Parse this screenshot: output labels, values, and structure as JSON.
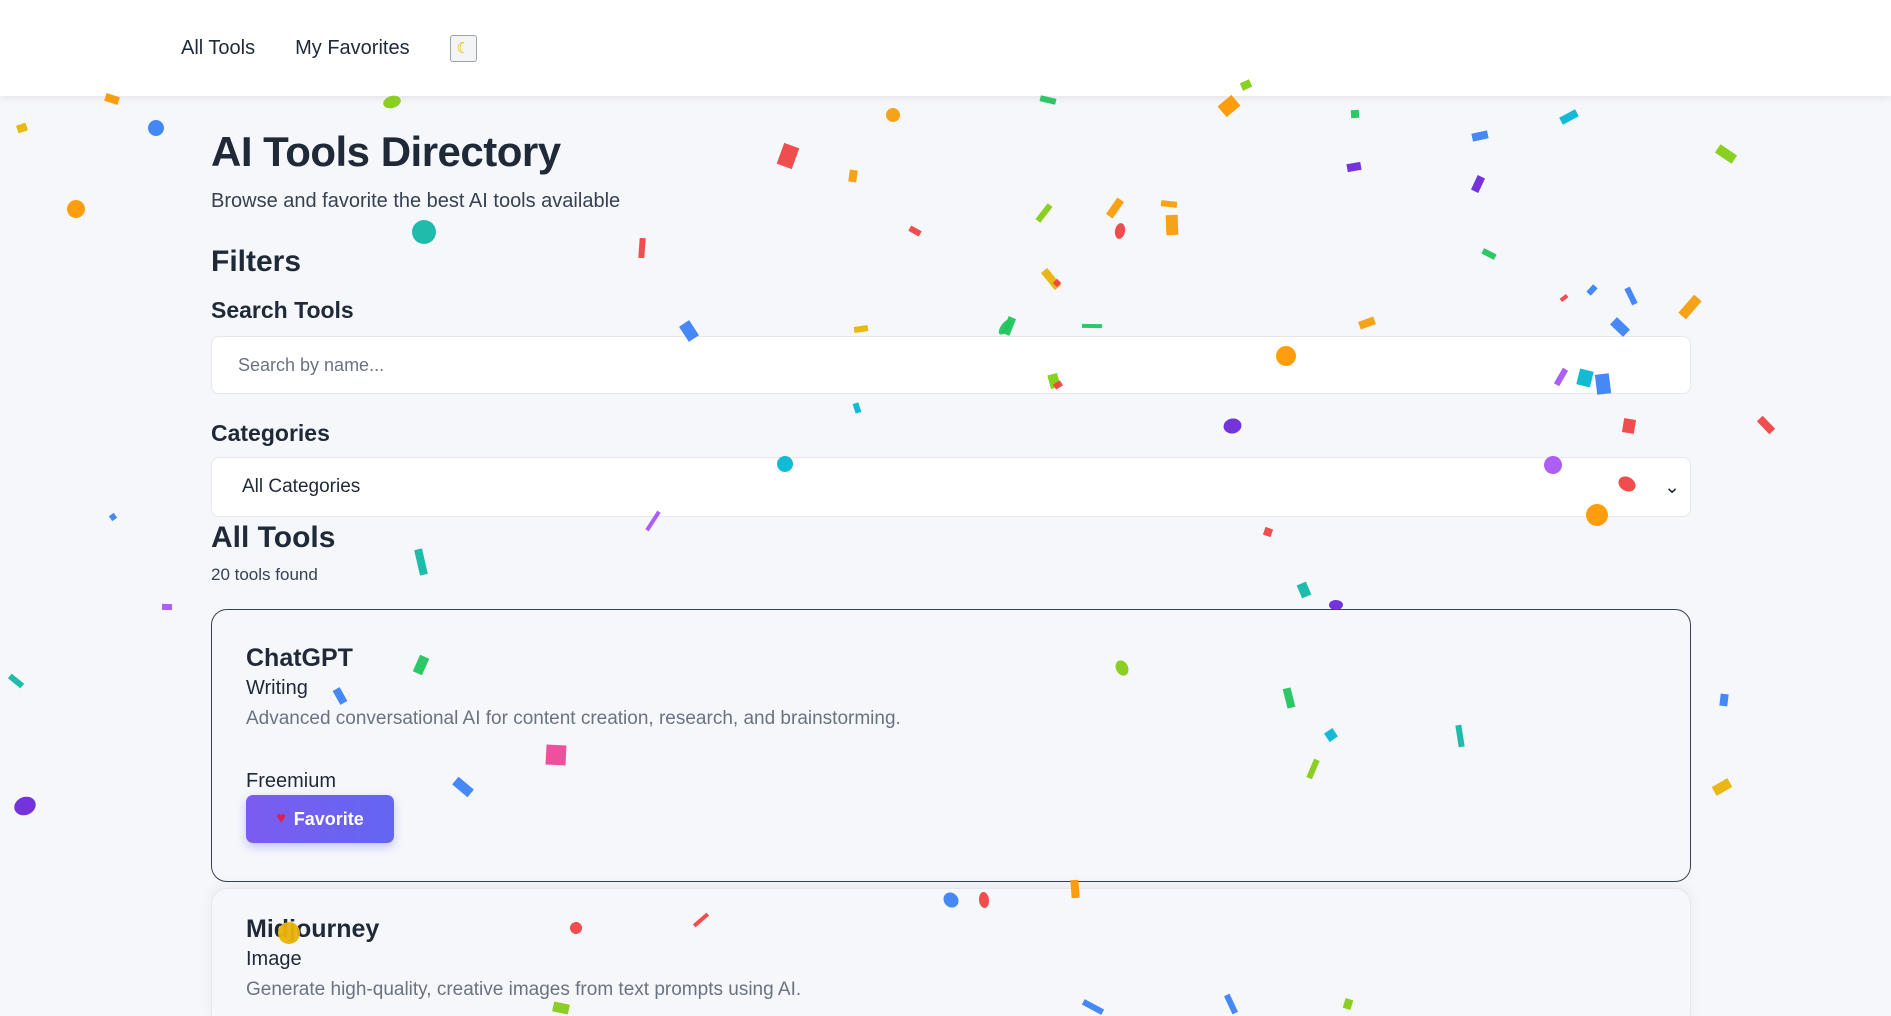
{
  "nav": {
    "all_tools": "All Tools",
    "my_favorites": "My Favorites",
    "theme_icon": "moon-icon"
  },
  "header": {
    "title": "AI Tools Directory",
    "subtitle": "Browse and favorite the best AI tools available"
  },
  "filters": {
    "title": "Filters",
    "search_label": "Search Tools",
    "search_placeholder": "Search by name...",
    "categories_label": "Categories",
    "category_selected": "All Categories"
  },
  "results": {
    "title": "All Tools",
    "count": "20 tools found"
  },
  "tools": [
    {
      "name": "ChatGPT",
      "category": "Writing",
      "description": "Advanced conversational AI for content creation, research, and brainstorming.",
      "pricing": "Freemium",
      "favorite_label": "Favorite"
    },
    {
      "name": "Midjourney",
      "category": "Image",
      "description": "Generate high-quality, creative images from text prompts using AI."
    }
  ],
  "colors": {
    "accent": "#6366f1",
    "confetti": [
      "#ef4444",
      "#f59e0b",
      "#eab308",
      "#22c55e",
      "#06b6d4",
      "#3b82f6",
      "#6d28d9",
      "#ec4899",
      "#84cc16",
      "#14b8a6",
      "#a855f7",
      "#ff9800"
    ]
  }
}
